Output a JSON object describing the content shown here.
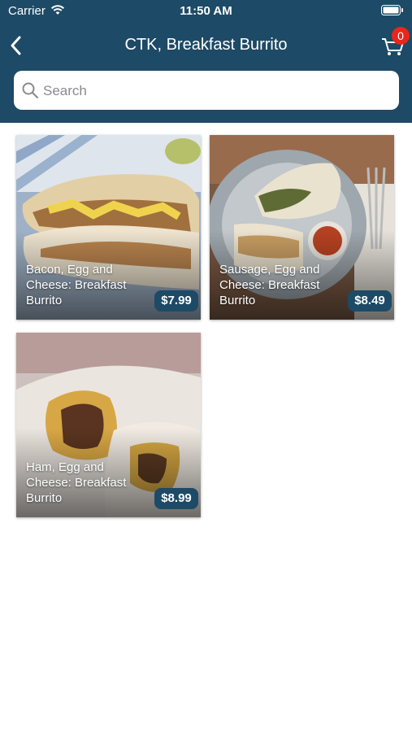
{
  "status_bar": {
    "carrier": "Carrier",
    "time": "11:50 AM"
  },
  "nav": {
    "title": "CTK, Breakfast Burrito",
    "cart_count": "0"
  },
  "search": {
    "placeholder": "Search",
    "value": ""
  },
  "items": [
    {
      "name": "Bacon, Egg and Cheese: Breakfast Burrito",
      "price": "$7.99"
    },
    {
      "name": "Sausage, Egg and Cheese: Breakfast Burrito",
      "price": "$8.49"
    },
    {
      "name": "Ham, Egg and Cheese: Breakfast Burrito",
      "price": "$8.99"
    }
  ],
  "colors": {
    "header": "#1d4a66",
    "badge": "#e8261c",
    "price_badge": "#1d4a66"
  }
}
